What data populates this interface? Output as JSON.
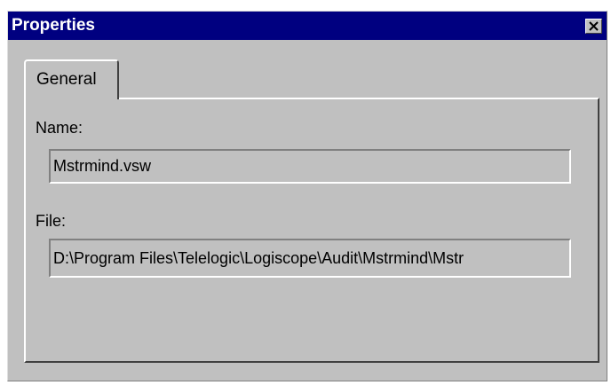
{
  "dialog": {
    "title": "Properties",
    "close_label": "Close"
  },
  "tabs": [
    {
      "label": "General",
      "selected": true
    }
  ],
  "general": {
    "name_label": "Name:",
    "name_value": "Mstrmind.vsw",
    "file_label": "File:",
    "file_value": "D:\\Program Files\\Telelogic\\Logiscope\\Audit\\Mstrmind\\Mstr"
  },
  "colors": {
    "titlebar": "#000080",
    "face": "#c0c0c0",
    "title_text": "#ffffff"
  },
  "icons": {
    "close": "close-icon"
  }
}
